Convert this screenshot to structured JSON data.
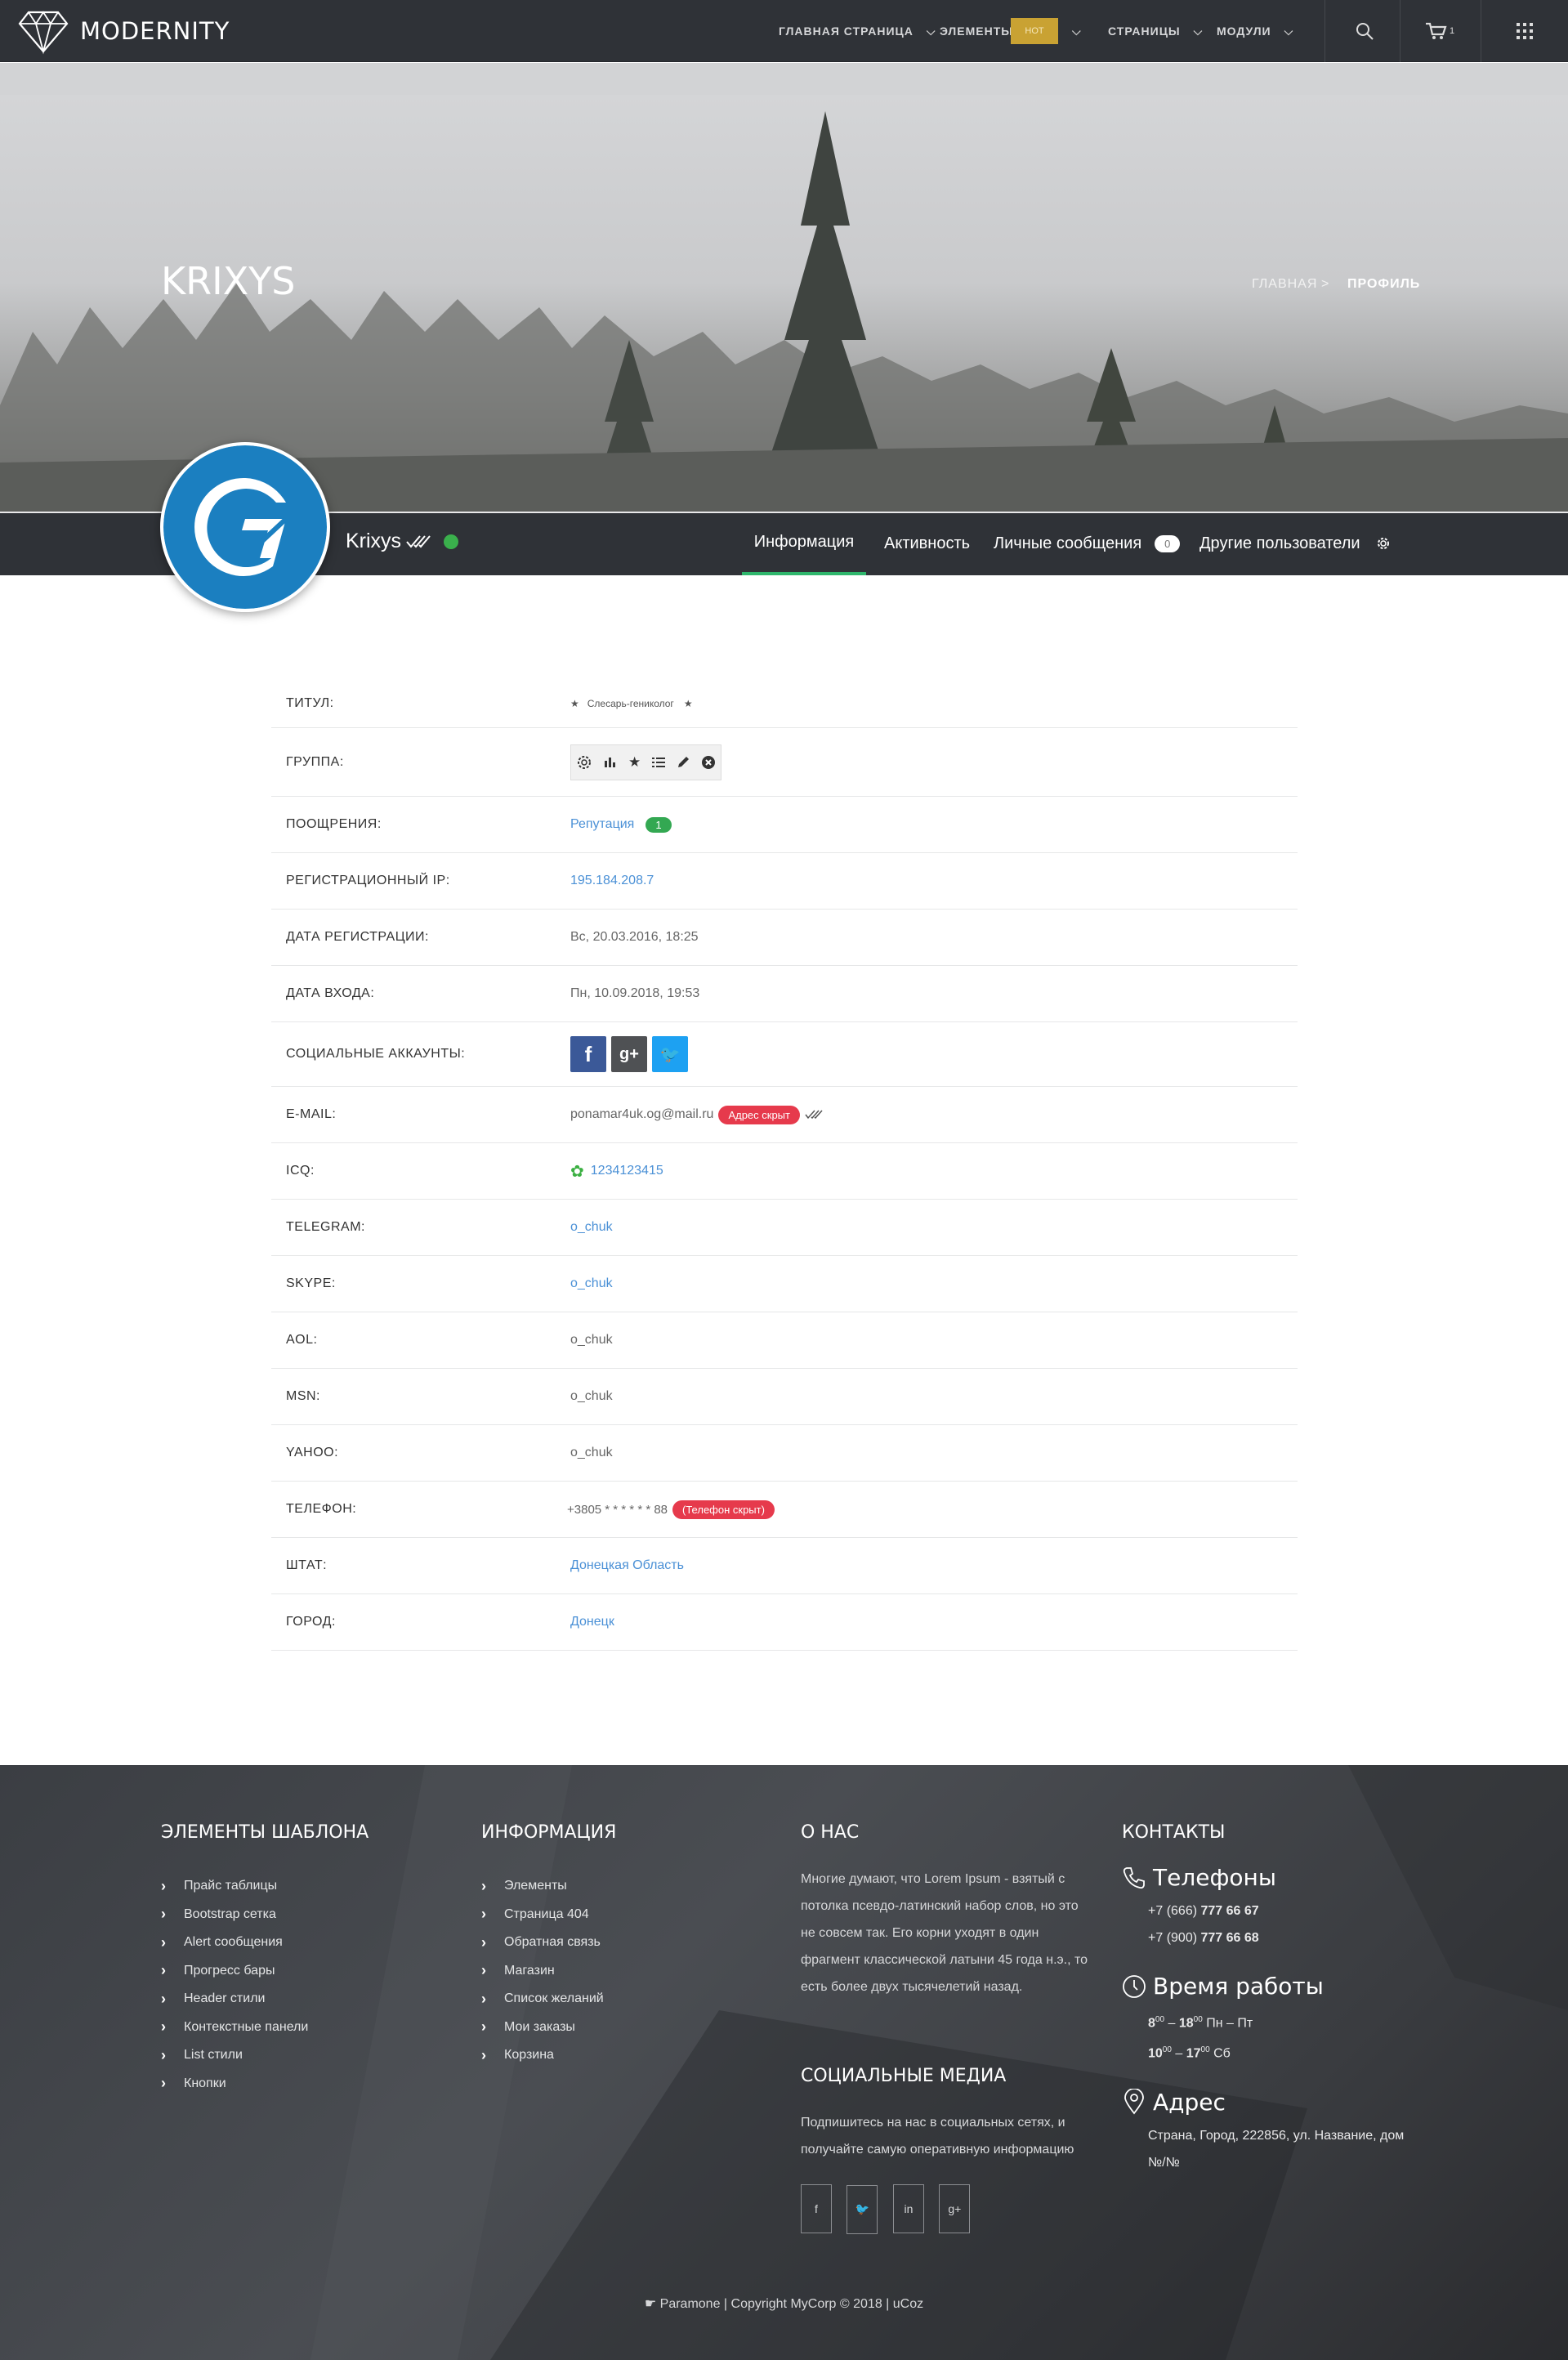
{
  "brand": {
    "name": "MODERNITY"
  },
  "nav": {
    "items": [
      "ГЛАВНАЯ СТРАНИЦА",
      "ЭЛЕМЕНТЫ",
      "СТРАНИЦЫ",
      "МОДУЛИ"
    ],
    "hot_badge": "HOT",
    "cart_count": "1"
  },
  "hero": {
    "title": "KRIXYS",
    "breadcrumb": [
      "ГЛАВНАЯ",
      "ПРОФИЛЬ"
    ],
    "breadcrumb_sep": ">"
  },
  "profile": {
    "username": "Krixys",
    "status": "online",
    "avatar_letter": "G",
    "tabs": [
      "Информация",
      "Активность",
      "Личные сообщения",
      "Другие пользователи"
    ],
    "messages_count": "0"
  },
  "info": {
    "title_label": "ТИТУЛ:",
    "title_value": "Слесарь-гениколог",
    "group_label": "ГРУППА:",
    "awards_label": "ПООЩРЕНИЯ:",
    "awards_link": "Репутация",
    "awards_count": "1",
    "ip_label": "РЕГИСТРАЦИОННЫЙ IP:",
    "ip_value": "195.184.208.7",
    "regdate_label": "ДАТА РЕГИСТРАЦИИ:",
    "regdate_value": "Вс, 20.03.2016, 18:25",
    "logindate_label": "ДАТА ВХОДА:",
    "logindate_value": "Пн, 10.09.2018, 19:53",
    "social_label": "СОЦИАЛЬНЫЕ АККАУНТЫ:",
    "email_label": "E-MAIL:",
    "email_value": "ponamar4uk.og@mail.ru",
    "email_badge": "Адрес скрыт",
    "icq_label": "ICQ:",
    "icq_value": "1234123415",
    "telegram_label": "TELEGRAM:",
    "telegram_value": "o_chuk",
    "skype_label": "SKYPE:",
    "skype_value": "o_chuk",
    "aol_label": "AOL:",
    "aol_value": "o_chuk",
    "msn_label": "MSN:",
    "msn_value": "o_chuk",
    "yahoo_label": "YAHOO:",
    "yahoo_value": "o_chuk",
    "phone_label": "ТЕЛЕФОН:",
    "phone_value": "+3805 * * * * * * 88",
    "phone_badge": "(Телефон скрыт)",
    "state_label": "ШТАТ:",
    "state_value": "Донецкая Область",
    "city_label": "ГОРОД:",
    "city_value": "Донецк"
  },
  "footer": {
    "col1_title": "ЭЛЕМЕНТЫ ШАБЛОНА",
    "col1_items": [
      "Прайс таблицы",
      "Bootstrap сетка",
      "Alert сообщения",
      "Прогресс бары",
      "Header стили",
      "Контекстные панели",
      "List стили",
      "Кнопки"
    ],
    "col2_title": "ИНФОРМАЦИЯ",
    "col2_items": [
      "Элементы",
      "Страница 404",
      "Обратная связь",
      "Магазин",
      "Список желаний",
      "Мои заказы",
      "Корзина"
    ],
    "about_title": "О НАС",
    "about_lines": [
      "Многие думают, что Lorem Ipsum - взятый с",
      "потолка псевдо-латинский набор слов, но это",
      "не совсем так. Его корни уходят в один",
      "фрагмент классической латыни 45 года н.э., то",
      "есть более двух тысячелетий назад."
    ],
    "social_title": "СОЦИАЛЬНЫЕ МЕДИА",
    "social_lines": [
      "Подпишитесь на нас в социальных сетях, и",
      "получайте самую оперативную информацию"
    ],
    "contacts_title": "КОНТАКТЫ",
    "phones_title": "Телефоны",
    "phone1_prefix": "+7 (666)",
    "phone1_num": "777 66 67",
    "phone2_prefix": "+7 (900)",
    "phone2_num": "777 66 68",
    "hours_title": "Время работы",
    "hours1_from": "8",
    "hours1_to": "18",
    "hours1_days": "Пн – Пт",
    "hours2_from": "10",
    "hours2_to": "17",
    "hours2_days": "Сб",
    "minutes": "00",
    "dash": "–",
    "address_title": "Адрес",
    "address_lines": [
      "Страна, Город, 222856, ул. Название, дом",
      "№/№"
    ],
    "copyright": "Paramone | Copyright MyCorp © 2018 | uCoz"
  },
  "colors": {
    "accent_green": "#2eb66c",
    "hot": "#c9a233",
    "link": "#4a90d6",
    "badge_red": "#e63a4c",
    "dark_bar": "#2f3237"
  }
}
